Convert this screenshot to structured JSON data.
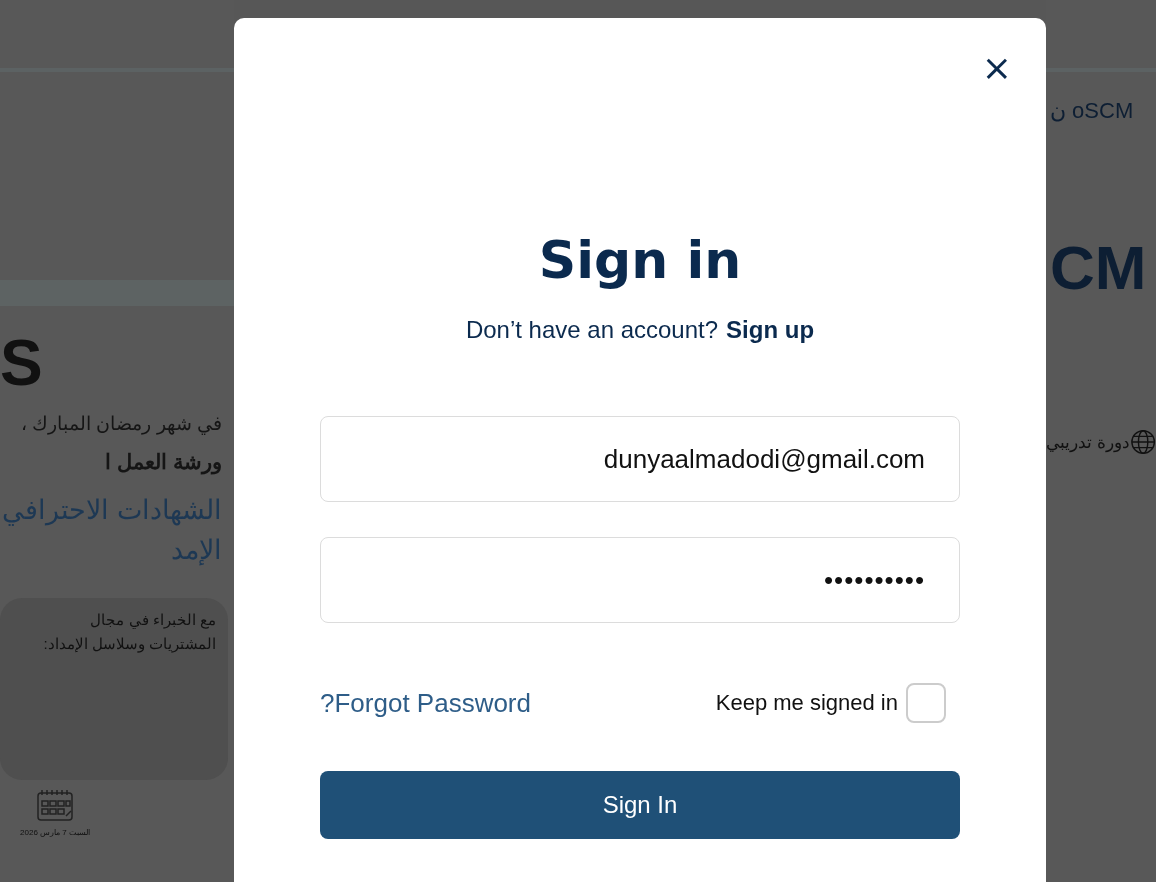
{
  "background_left": {
    "logo_fragment": "S",
    "lines": [
      {
        "text": "في شهر رمضان المبارك ،",
        "kind": "intro"
      },
      {
        "text": "ورشة العمل ا",
        "kind": "heading"
      },
      {
        "text": "الشهادات الاحترافي",
        "kind": "title"
      },
      {
        "text": "الإمد",
        "kind": "title"
      }
    ],
    "card": {
      "lines": [
        "مع الخبراء  في مجال",
        "المشتريات وسلاسل الإمداد:"
      ]
    },
    "date": "السبت 7 مارس 2026"
  },
  "background_right": {
    "subtitle": "ن oSCM",
    "logo_fragment": "CM",
    "course": "دورة تدريبي"
  },
  "dialog": {
    "close": "×",
    "title": "Sign in",
    "prompt": "Don’t have an account?",
    "signup_link": "Sign up",
    "email": {
      "value": "dunyaalmadodi@gmail.com"
    },
    "password": {
      "value": "••••••••••"
    },
    "forgot_link": "?Forgot Password",
    "keep_signed_in": {
      "label": "Keep me signed in",
      "checked": false
    },
    "submit": "Sign In"
  }
}
